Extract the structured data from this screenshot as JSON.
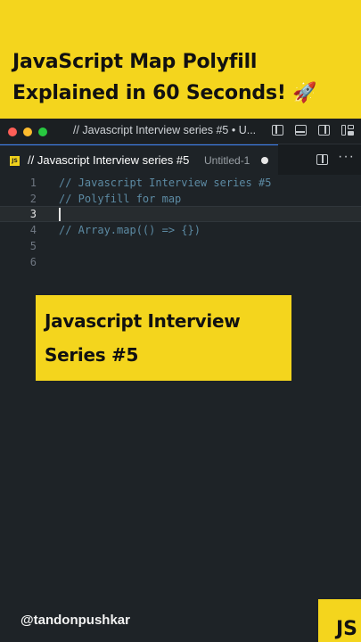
{
  "banner": {
    "title_line1": "JavaScript Map Polyfill",
    "title_line2": "Explained in 60 Seconds! 🚀"
  },
  "titlebar": {
    "window_title": "// Javascript Interview series #5 • U..."
  },
  "tab": {
    "badge": "JS",
    "label": "// Javascript Interview series #5",
    "description": "Untitled-1",
    "more": "···"
  },
  "editor": {
    "lines": [
      {
        "number": "1",
        "text": "// Javascript Interview series #5"
      },
      {
        "number": "2",
        "text": "// Polyfill for map"
      },
      {
        "number": "3",
        "text": ""
      },
      {
        "number": "4",
        "text": "// Array.map(() => {})"
      },
      {
        "number": "5",
        "text": ""
      },
      {
        "number": "6",
        "text": ""
      }
    ]
  },
  "card": {
    "line1": "Javascript Interview",
    "line2": "Series #5"
  },
  "footer": {
    "handle": "@tandonpushkar",
    "logo": "JS"
  },
  "colors": {
    "accent_yellow": "#f4d51d",
    "editor_bg": "#1e2327",
    "comment": "#5c8aa3"
  }
}
